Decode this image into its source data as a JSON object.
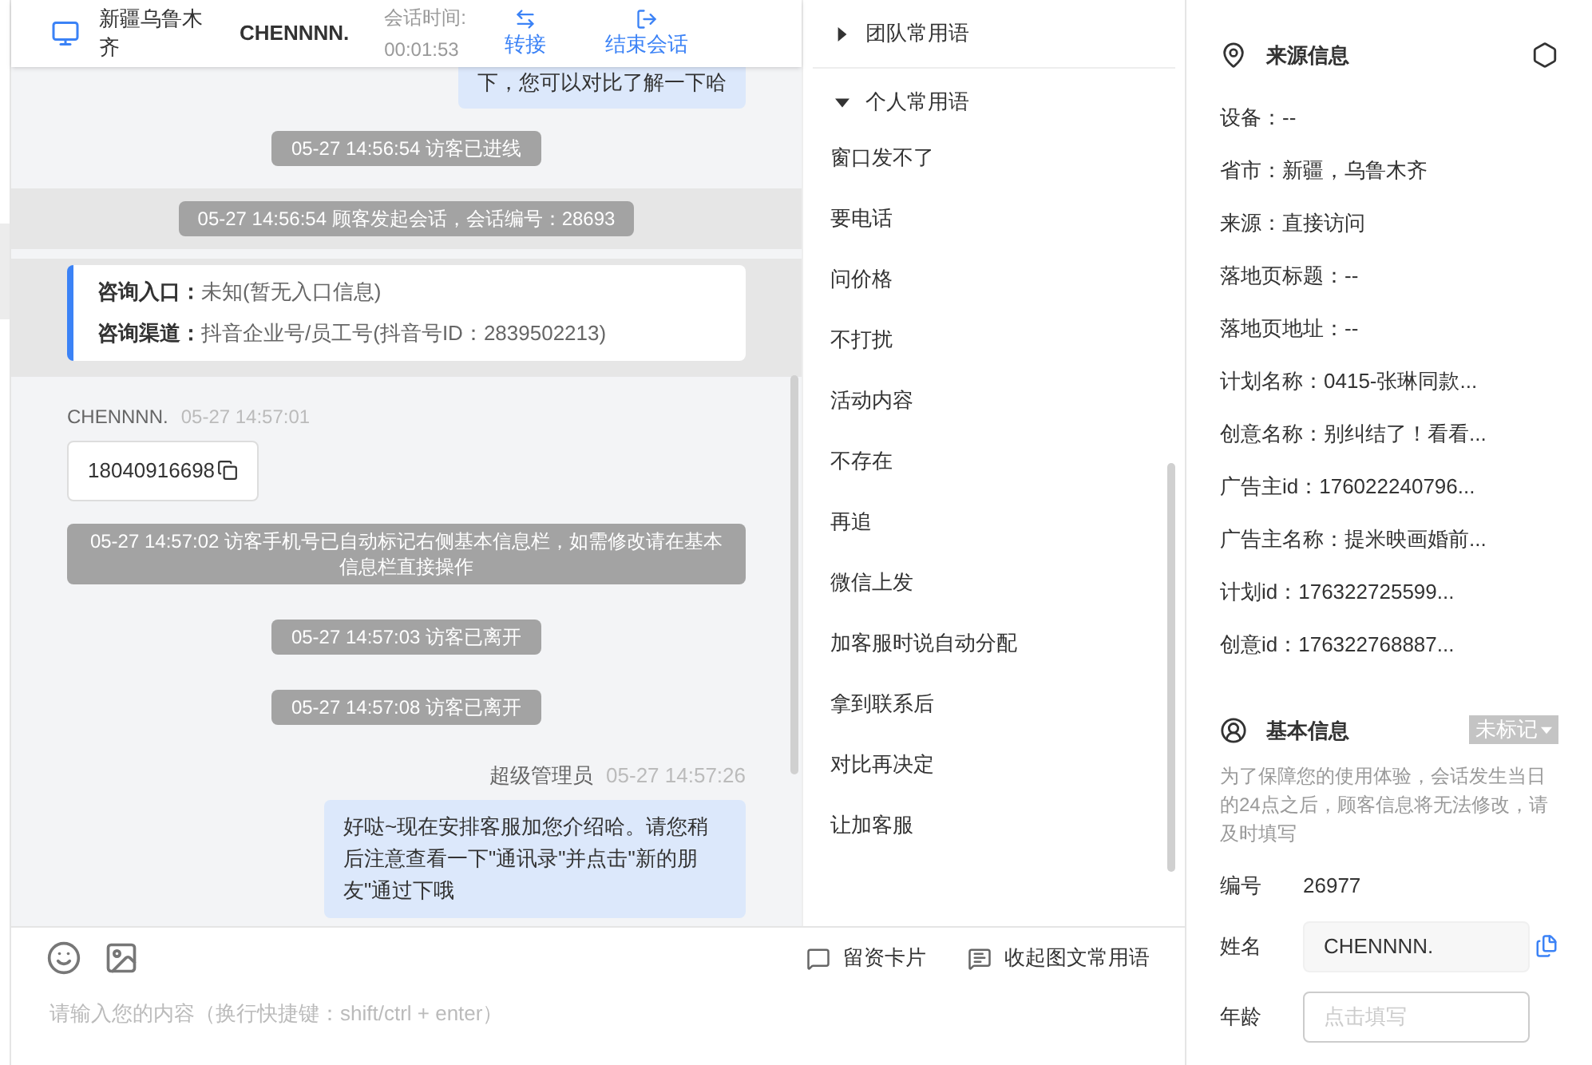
{
  "header": {
    "location": "新疆乌鲁木齐",
    "visitor": "CHENNNN.",
    "session_time_label": "会话时间:",
    "session_time": "00:01:53",
    "actions": [
      {
        "kind": "transfer",
        "label": "转接"
      },
      {
        "kind": "end",
        "label": "结束会话"
      }
    ]
  },
  "messages": [
    {
      "kind": "agent_tail",
      "text": "下，您可以对比了解一下哈"
    },
    {
      "kind": "system",
      "text": "05-27 14:56:54 访客已进线"
    },
    {
      "kind": "system",
      "text": "05-27 14:56:54 顾客发起会话，会话编号：28693",
      "highlighted": true
    },
    {
      "kind": "info",
      "highlighted": true,
      "rows": [
        {
          "label": "咨询入口：",
          "value": "未知(暂无入口信息)"
        },
        {
          "label": "咨询渠道：",
          "value": "抖音企业号/员工号(抖音号ID：2839502213)"
        }
      ]
    },
    {
      "kind": "visitor",
      "sender": "CHENNNN.",
      "time": "05-27 14:57:01",
      "text": "18040916698"
    },
    {
      "kind": "system",
      "text": "05-27 14:57:02 访客手机号已自动标记右侧基本信息栏，如需修改请在基本信息栏直接操作"
    },
    {
      "kind": "system",
      "text": "05-27 14:57:03 访客已离开"
    },
    {
      "kind": "system",
      "text": "05-27 14:57:08 访客已离开"
    },
    {
      "kind": "agent",
      "sender": "超级管理员",
      "time": "05-27 14:57:26",
      "text": "好哒~现在安排客服加您介绍哈。请您稍后注意查看一下\"通讯录\"并点击\"新的朋友\"通过下哦"
    }
  ],
  "composer": {
    "tools": [
      {
        "kind": "card",
        "label": "留资卡片"
      },
      {
        "kind": "phrases",
        "label": "收起图文常用语"
      }
    ],
    "placeholder": "请输入您的内容（换行快捷键：shift/ctrl + enter）"
  },
  "phrase_groups": [
    {
      "title": "团队常用语",
      "expanded": false
    },
    {
      "title": "个人常用语",
      "expanded": true,
      "items": [
        "窗口发不了",
        "要电话",
        "问价格",
        "不打扰",
        "活动内容",
        "不存在",
        "再追",
        "微信上发",
        "加客服时说自动分配",
        "拿到联系后",
        "对比再决定",
        "让加客服"
      ]
    }
  ],
  "source_info": {
    "title": "来源信息",
    "rows": [
      "设备：--",
      "省市：新疆，乌鲁木齐",
      "来源：直接访问",
      "落地页标题：--",
      "落地页地址：--",
      "计划名称：0415-张琳同款...",
      "创意名称：别纠结了！看看...",
      "广告主id：176022240796...",
      "广告主名称：提米映画婚前...",
      "计划id：176322725599...",
      "创意id：176322768887..."
    ]
  },
  "basic_info": {
    "title": "基本信息",
    "tag": "未标记",
    "notice": "为了保障您的使用体验，会话发生当日的24点之后，顾客信息将无法修改，请及时填写",
    "fields": [
      {
        "kind": "text",
        "label": "编号",
        "value": "26977"
      },
      {
        "kind": "input",
        "label": "姓名",
        "value": "CHENNNN."
      },
      {
        "kind": "input",
        "label": "年龄",
        "placeholder": "点击填写"
      }
    ]
  }
}
